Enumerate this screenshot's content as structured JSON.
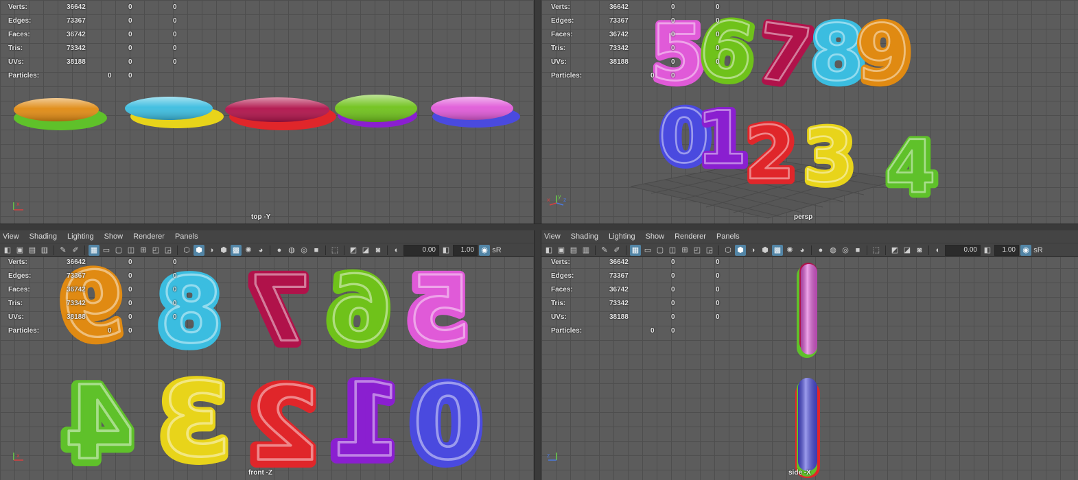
{
  "hud": {
    "verts_label": "Verts:",
    "edges_label": "Edges:",
    "faces_label": "Faces:",
    "tris_label": "Tris:",
    "uvs_label": "UVs:",
    "particles_label": "Particles:",
    "verts": "36642",
    "edges": "73367",
    "faces": "36742",
    "tris": "73342",
    "uvs": "38188",
    "zero": "0"
  },
  "viewports": {
    "top": {
      "label": "top -Y"
    },
    "persp": {
      "label": "persp"
    },
    "front": {
      "label": "front -Z"
    },
    "side": {
      "label": "side -X"
    }
  },
  "menu": [
    "View",
    "Shading",
    "Lighting",
    "Show",
    "Renderer",
    "Panels"
  ],
  "toolbar": {
    "exposure": "0.00",
    "gamma": "1.00",
    "colorspace_icon": "sRGB-icon"
  },
  "digits_front_row1": [
    "9",
    "8",
    "7",
    "6",
    "5"
  ],
  "digits_front_row2": [
    "4",
    "3",
    "2",
    "1",
    "0"
  ],
  "digits_persp_row1": [
    "5",
    "6",
    "7",
    "8",
    "9"
  ],
  "digits_persp_row2": [
    "0",
    "1",
    "2",
    "3",
    "4"
  ],
  "colors": {
    "orange": "#e08a12",
    "cyan": "#3bbde0",
    "crimson": "#b0124a",
    "lime": "#6fc21a",
    "magenta": "#e05ad8",
    "blue": "#4a4adf",
    "purple": "#8a1fd0",
    "red": "#e0262a",
    "yellow": "#e8d41a",
    "green": "#5fc12a",
    "grid": "#5c5c5c",
    "grid_line": "#4e4e4e",
    "panel_bar": "#444444",
    "highlight": "#5285a6"
  }
}
